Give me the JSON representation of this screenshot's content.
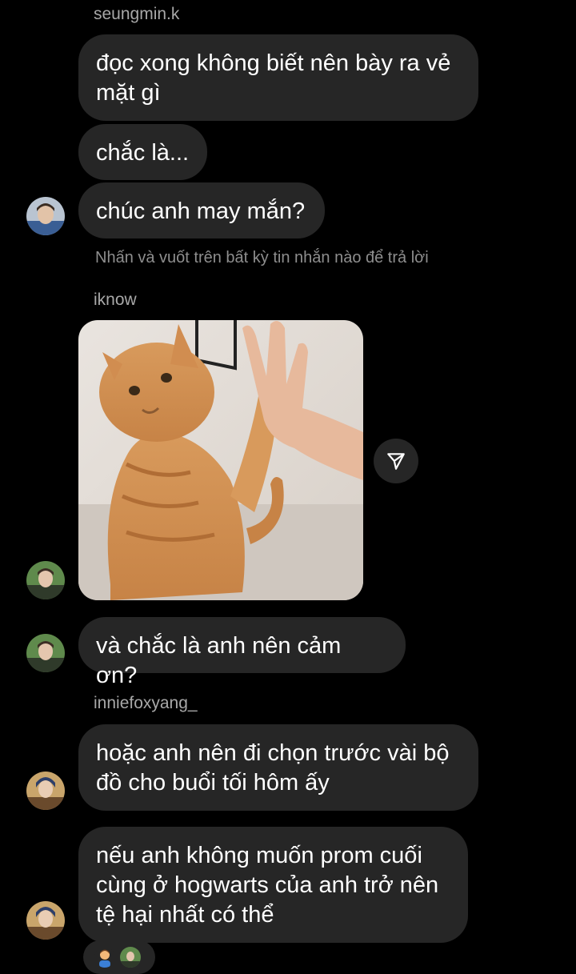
{
  "thread": {
    "groups": [
      {
        "sender": "seungmin.k",
        "messages": [
          "đọc xong không biết nên bày ra vẻ mặt gì",
          "chắc là...",
          "chúc anh may mắn?"
        ]
      },
      {
        "sender": "iknow",
        "messages": [
          "và chắc là anh nên cảm ơn?"
        ]
      },
      {
        "sender": "inniefoxyang_",
        "messages": [
          "hoặc anh nên đi chọn trước vài bộ đồ cho buổi tối hôm ấy",
          "nếu anh không muốn prom cuối cùng ở hogwarts của anh trở nên tệ hại nhất có thể"
        ]
      }
    ],
    "reply_hint": "Nhấn và vuốt trên bất kỳ tin nhắn nào để trả lời"
  },
  "icons": {
    "share": "paper-plane-icon"
  },
  "colors": {
    "background": "#000000",
    "bubble": "#262626",
    "sender_text": "#a8a8a8",
    "hint_text": "#8e8e8e"
  }
}
